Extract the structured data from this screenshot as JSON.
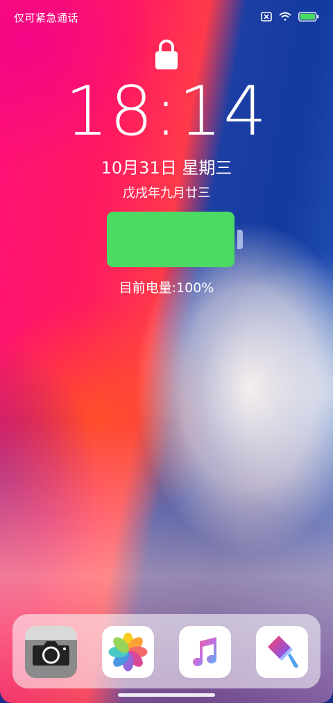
{
  "status_bar": {
    "carrier_text": "仅可紧急通话",
    "icons": [
      "no-sim-icon",
      "wifi-icon",
      "battery-icon"
    ],
    "battery_color": "#4cd964"
  },
  "lockscreen": {
    "lock_icon": "lock-icon",
    "time": "18:14",
    "date": "10月31日 星期三",
    "lunar_date": "戊戌年九月廿三",
    "battery_level_text": "目前电量:100%",
    "battery_level": 1.0,
    "battery_color": "#4cd964"
  },
  "dock": {
    "apps": [
      {
        "name": "camera",
        "icon": "camera-icon"
      },
      {
        "name": "photos",
        "icon": "photos-icon"
      },
      {
        "name": "music",
        "icon": "music-icon"
      },
      {
        "name": "theme",
        "icon": "paintbrush-icon"
      }
    ]
  }
}
